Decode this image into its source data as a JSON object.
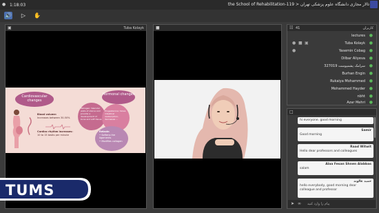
{
  "topbar": {
    "time": "1:18:03",
    "title": "the School of Rehabilitation-119 > تالار مجازی دانشگاه علوم پزشکی تهران"
  },
  "toolbar": {
    "icons": [
      "speaker-icon",
      "screen-share-icon",
      "raise-hand-icon"
    ]
  },
  "share_panel": {
    "presenter": "Tuba Kolayk"
  },
  "slide": {
    "cardio": "Cardiovascular changes",
    "hormonal": "Hormonal changes",
    "blood_volume_title": "Blood volume:",
    "blood_volume_text": "Increases between 30-50%",
    "cardiac_title": "Cardiac rhythm increases:",
    "cardiac_text": "10 to 15 beats per minute",
    "estrogen": "Estrogen: Vascular walls of uterus and provide a development of bone and soft tissue",
    "progesterone": "Progesterone: Slows intestinal reabsorption, decreases ...",
    "relaxin_title": "Relaxin",
    "relaxin_items": [
      "Softens the ligaments",
      "Modifies collagen"
    ]
  },
  "video_panel": {
    "header": ""
  },
  "users_panel": {
    "count": "41",
    "header": "کاربران",
    "users": [
      "lectures",
      "Tuba Kolayk",
      "Yasemin Cobag",
      "Dilbar Aliyeva",
      "سرامک پشمپوست 327019",
      "Burhan Engin",
      "Rukaiya Mohammed",
      "Mohammed Hayder",
      "nbht",
      "Azar Mehri"
    ]
  },
  "chat": {
    "messages": [
      {
        "sender": "",
        "text": "hi everyone. good morning"
      },
      {
        "sender": "Samir",
        "text": "Good morning"
      },
      {
        "sender": "Raad Witwit",
        "text": "Hello dear professors and colleagues"
      },
      {
        "sender": "Alaa Fesan Shnen Alabbas",
        "text": "salam"
      },
      {
        "sender": "حمید عالوند",
        "text": "hello everybody, good morning dear colleague and professor"
      }
    ],
    "input_placeholder": "پیام را وارد کنید"
  },
  "logo": {
    "text": "TUMS"
  },
  "colors": {
    "accent": "#4b6fb0",
    "slide_bg": "#f4dcd6",
    "bubble": "#b05a8a"
  }
}
